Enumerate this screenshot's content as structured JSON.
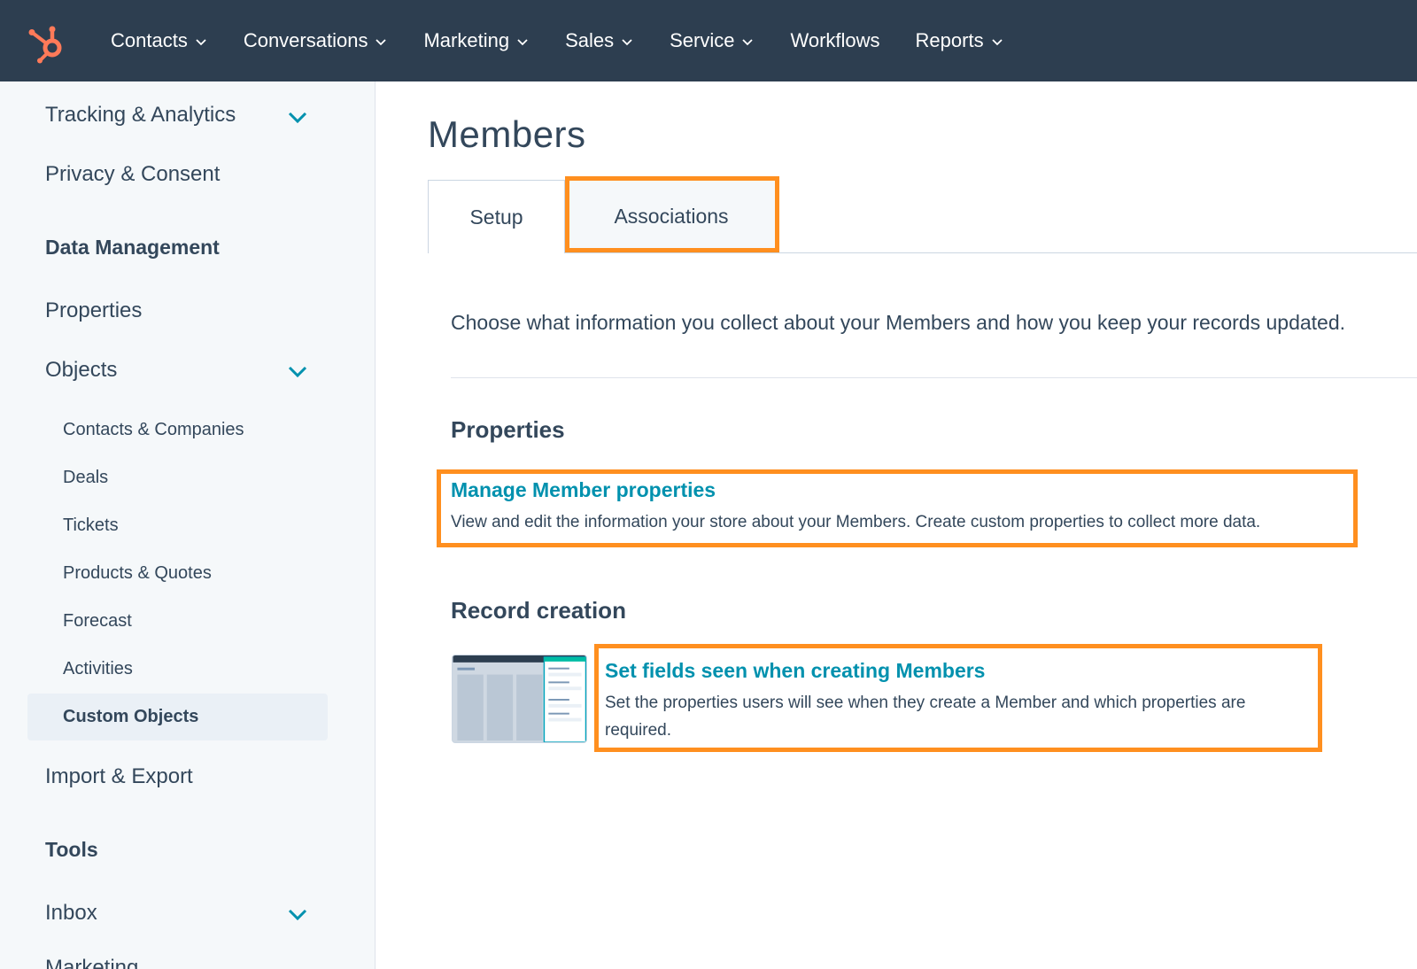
{
  "nav": {
    "items": [
      {
        "label": "Contacts",
        "dropdown": true
      },
      {
        "label": "Conversations",
        "dropdown": true
      },
      {
        "label": "Marketing",
        "dropdown": true
      },
      {
        "label": "Sales",
        "dropdown": true
      },
      {
        "label": "Service",
        "dropdown": true
      },
      {
        "label": "Workflows",
        "dropdown": false
      },
      {
        "label": "Reports",
        "dropdown": true
      }
    ]
  },
  "sidebar": {
    "tracking_analytics": "Tracking & Analytics",
    "privacy_consent": "Privacy & Consent",
    "data_management": "Data Management",
    "properties": "Properties",
    "objects": "Objects",
    "contacts_companies": "Contacts & Companies",
    "deals": "Deals",
    "tickets": "Tickets",
    "products_quotes": "Products & Quotes",
    "forecast": "Forecast",
    "activities": "Activities",
    "custom_objects": "Custom Objects",
    "import_export": "Import & Export",
    "tools": "Tools",
    "inbox": "Inbox",
    "marketing_partial": "Marketing"
  },
  "main": {
    "title": "Members",
    "tabs": [
      {
        "label": "Setup",
        "active": true
      },
      {
        "label": "Associations",
        "active": false
      }
    ],
    "intro": "Choose what information you collect about your Members and how you keep your records updated.",
    "properties_section": {
      "title": "Properties",
      "link": "Manage Member properties",
      "description": "View and edit the information your store about your Members. Create custom properties to collect more data."
    },
    "record_section": {
      "title": "Record creation",
      "link": "Set fields seen when creating Members",
      "description": "Set the properties users will see when they create a Member and which properties are required."
    }
  },
  "colors": {
    "nav_bg": "#2d3e50",
    "accent_link": "#0091ae",
    "highlight": "#ff8f1f",
    "logo": "#ff7a59"
  }
}
